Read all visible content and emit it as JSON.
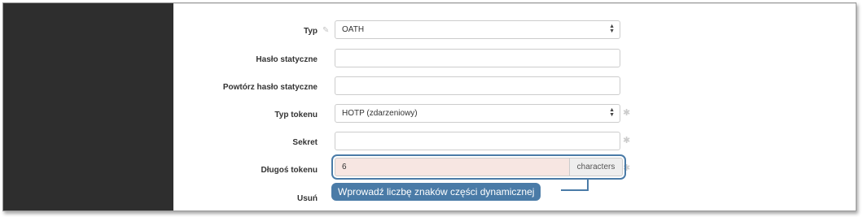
{
  "form": {
    "fields": [
      {
        "label": "Typ",
        "value": "OATH",
        "control": "select",
        "edit_icon": "edit-icon"
      },
      {
        "label": "Hasło statyczne",
        "value": "",
        "control": "password"
      },
      {
        "label": "Powtórz hasło statyczne",
        "value": "",
        "control": "password"
      },
      {
        "label": "Typ tokenu",
        "value": "HOTP (zdarzeniowy)",
        "control": "select",
        "required": true
      },
      {
        "label": "Sekret",
        "value": "",
        "control": "text",
        "required": true
      },
      {
        "label": "Długoś tokenu",
        "value": "6",
        "control": "text",
        "addon": "characters",
        "required": true
      },
      {
        "label": "Usuń"
      }
    ]
  },
  "callout": {
    "text": "Wprowadź liczbę znaków części dynamicznej",
    "color": "#4a7ba7"
  },
  "colors": {
    "sidebar": "#2e2e2e",
    "highlight": "#4a7ba7",
    "invalid_input_bg": "#f7e6e2"
  }
}
